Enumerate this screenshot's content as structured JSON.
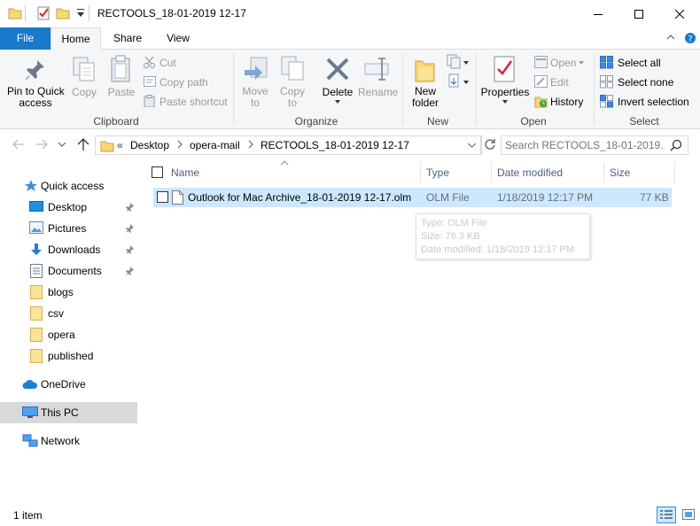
{
  "window": {
    "title": "RECTOOLS_18-01-2019 12-17"
  },
  "tabs": {
    "file": "File",
    "home": "Home",
    "share": "Share",
    "view": "View"
  },
  "ribbon": {
    "clipboard": {
      "pin": "Pin to Quick access",
      "pin_l1": "Pin to Quick",
      "pin_l2": "access",
      "copy": "Copy",
      "paste": "Paste",
      "cut": "Cut",
      "copy_path": "Copy path",
      "paste_shortcut": "Paste shortcut",
      "label": "Clipboard"
    },
    "organize": {
      "move_to": "Move to",
      "move_l1": "Move",
      "move_l2": "to",
      "copy_to": "Copy to",
      "copy_l1": "Copy",
      "copy_l2": "to",
      "delete": "Delete",
      "rename": "Rename",
      "label": "Organize"
    },
    "new": {
      "new_folder": "New folder",
      "nf_l1": "New",
      "nf_l2": "folder",
      "label": "New"
    },
    "open": {
      "properties": "Properties",
      "open": "Open",
      "edit": "Edit",
      "history": "History",
      "label": "Open"
    },
    "select": {
      "select_all": "Select all",
      "select_none": "Select none",
      "invert": "Invert selection",
      "label": "Select"
    }
  },
  "address": {
    "overflow": "«",
    "crumbs": [
      "Desktop",
      "opera-mail",
      "RECTOOLS_18-01-2019 12-17"
    ],
    "search_placeholder": "Search RECTOOLS_18-01-2019..."
  },
  "nav": {
    "quick_access": "Quick access",
    "items": [
      "Desktop",
      "Pictures",
      "Downloads",
      "Documents",
      "blogs",
      "csv",
      "opera",
      "published"
    ],
    "onedrive": "OneDrive",
    "this_pc": "This PC",
    "network": "Network"
  },
  "columns": {
    "name": "Name",
    "type": "Type",
    "date": "Date modified",
    "size": "Size"
  },
  "files": [
    {
      "name": "Outlook for Mac Archive_18-01-2019 12-17.olm",
      "type": "OLM File",
      "date": "1/18/2019 12:17 PM",
      "size": "77 KB"
    }
  ],
  "tooltip": {
    "type": "Type: OLM File",
    "size": "Size: 76.3 KB",
    "date": "Date modified: 1/18/2019 12:17 PM"
  },
  "status": {
    "count": "1 item"
  },
  "colors": {
    "accent": "#1979ca",
    "selection": "#cce8ff",
    "folder": "#f8d775",
    "header_text": "#4c607a"
  }
}
